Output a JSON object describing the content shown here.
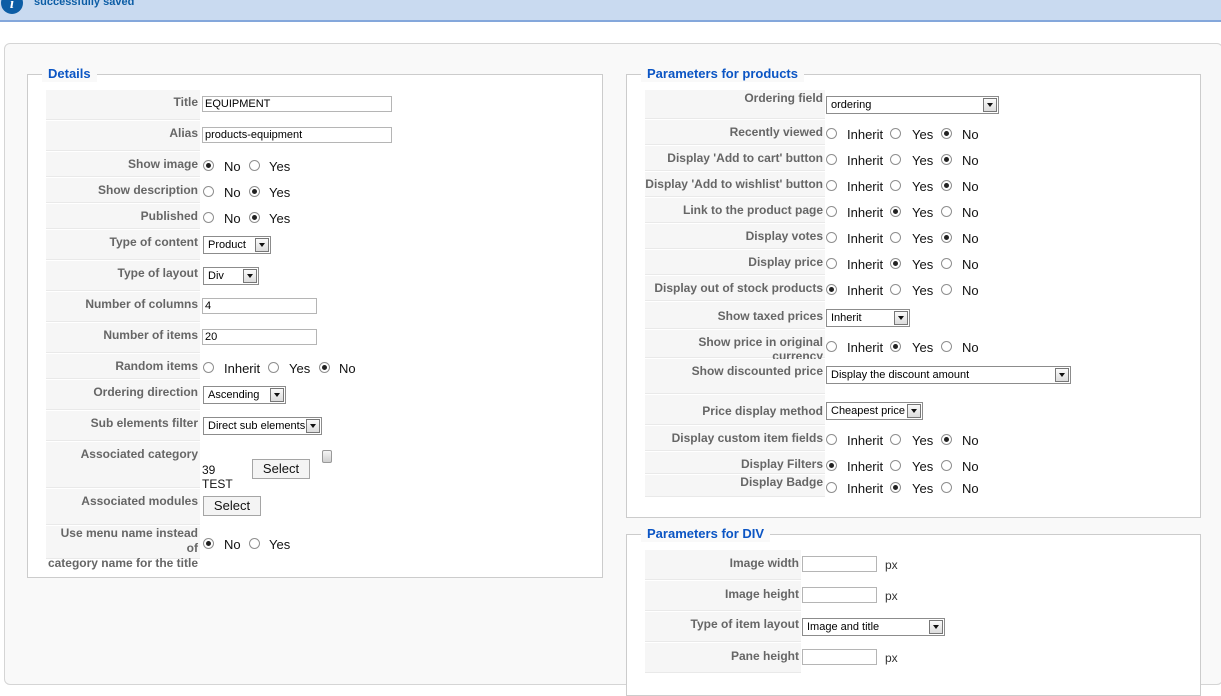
{
  "message": {
    "text": "successfully saved",
    "icon": "info-icon"
  },
  "details": {
    "legend": "Details",
    "title": {
      "label": "Title",
      "value": "EQUIPMENT"
    },
    "alias": {
      "label": "Alias",
      "value": "products-equipment"
    },
    "show_image": {
      "label": "Show image",
      "options": [
        "No",
        "Yes"
      ],
      "selected": "No"
    },
    "show_description": {
      "label": "Show description",
      "options": [
        "No",
        "Yes"
      ],
      "selected": "Yes"
    },
    "published": {
      "label": "Published",
      "options": [
        "No",
        "Yes"
      ],
      "selected": "Yes"
    },
    "type_of_content": {
      "label": "Type of content",
      "value": "Product"
    },
    "type_of_layout": {
      "label": "Type of layout",
      "value": "Div"
    },
    "number_of_columns": {
      "label": "Number of columns",
      "value": "4"
    },
    "number_of_items": {
      "label": "Number of items",
      "value": "20"
    },
    "random_items": {
      "label": "Random items",
      "options": [
        "Inherit",
        "Yes",
        "No"
      ],
      "selected": "No"
    },
    "ordering_direction": {
      "label": "Ordering direction",
      "value": "Ascending"
    },
    "sub_elements_filter": {
      "label": "Sub elements filter",
      "value": "Direct sub elements"
    },
    "associated_category": {
      "label": "Associated category",
      "value": "39 TEST",
      "button": "Select"
    },
    "associated_modules": {
      "label": "Associated modules",
      "button": "Select"
    },
    "use_menu_name": {
      "label_line1": "Use menu name instead of",
      "label_line2": "category name for the title",
      "options": [
        "No",
        "Yes"
      ],
      "selected": "No"
    }
  },
  "products": {
    "legend": "Parameters for products",
    "ordering_field": {
      "label": "Ordering field",
      "value": "ordering"
    },
    "recently_viewed": {
      "label": "Recently viewed",
      "options": [
        "Inherit",
        "Yes",
        "No"
      ],
      "selected": "No"
    },
    "add_to_cart": {
      "label": "Display 'Add to cart' button",
      "options": [
        "Inherit",
        "Yes",
        "No"
      ],
      "selected": "No"
    },
    "add_to_wishlist": {
      "label": "Display 'Add to wishlist' button",
      "options": [
        "Inherit",
        "Yes",
        "No"
      ],
      "selected": "No"
    },
    "link_to_product": {
      "label": "Link to the product page",
      "options": [
        "Inherit",
        "Yes",
        "No"
      ],
      "selected": "Yes"
    },
    "display_votes": {
      "label": "Display votes",
      "options": [
        "Inherit",
        "Yes",
        "No"
      ],
      "selected": "No"
    },
    "display_price": {
      "label": "Display price",
      "options": [
        "Inherit",
        "Yes",
        "No"
      ],
      "selected": "Yes"
    },
    "out_of_stock": {
      "label": "Display out of stock products",
      "options": [
        "Inherit",
        "Yes",
        "No"
      ],
      "selected": "Inherit"
    },
    "show_taxed": {
      "label": "Show taxed prices",
      "value": "Inherit"
    },
    "original_currency": {
      "label": "Show price in original currency",
      "options": [
        "Inherit",
        "Yes",
        "No"
      ],
      "selected": "Yes"
    },
    "discounted_price": {
      "label": "Show discounted price",
      "value": "Display the discount amount"
    },
    "price_method": {
      "label": "Price display method",
      "value": "Cheapest price"
    },
    "custom_fields": {
      "label": "Display custom item fields",
      "options": [
        "Inherit",
        "Yes",
        "No"
      ],
      "selected": "No"
    },
    "display_filters": {
      "label": "Display Filters",
      "options": [
        "Inherit",
        "Yes",
        "No"
      ],
      "selected": "Inherit"
    },
    "display_badge": {
      "label": "Display Badge",
      "options": [
        "Inherit",
        "Yes",
        "No"
      ],
      "selected": "Yes"
    }
  },
  "div": {
    "legend": "Parameters for DIV",
    "image_width": {
      "label": "Image width",
      "value": "",
      "unit": "px"
    },
    "image_height": {
      "label": "Image height",
      "value": "",
      "unit": "px"
    },
    "item_layout": {
      "label": "Type of item layout",
      "value": "Image and title"
    },
    "pane_height": {
      "label": "Pane height",
      "value": "",
      "unit": "px"
    }
  }
}
